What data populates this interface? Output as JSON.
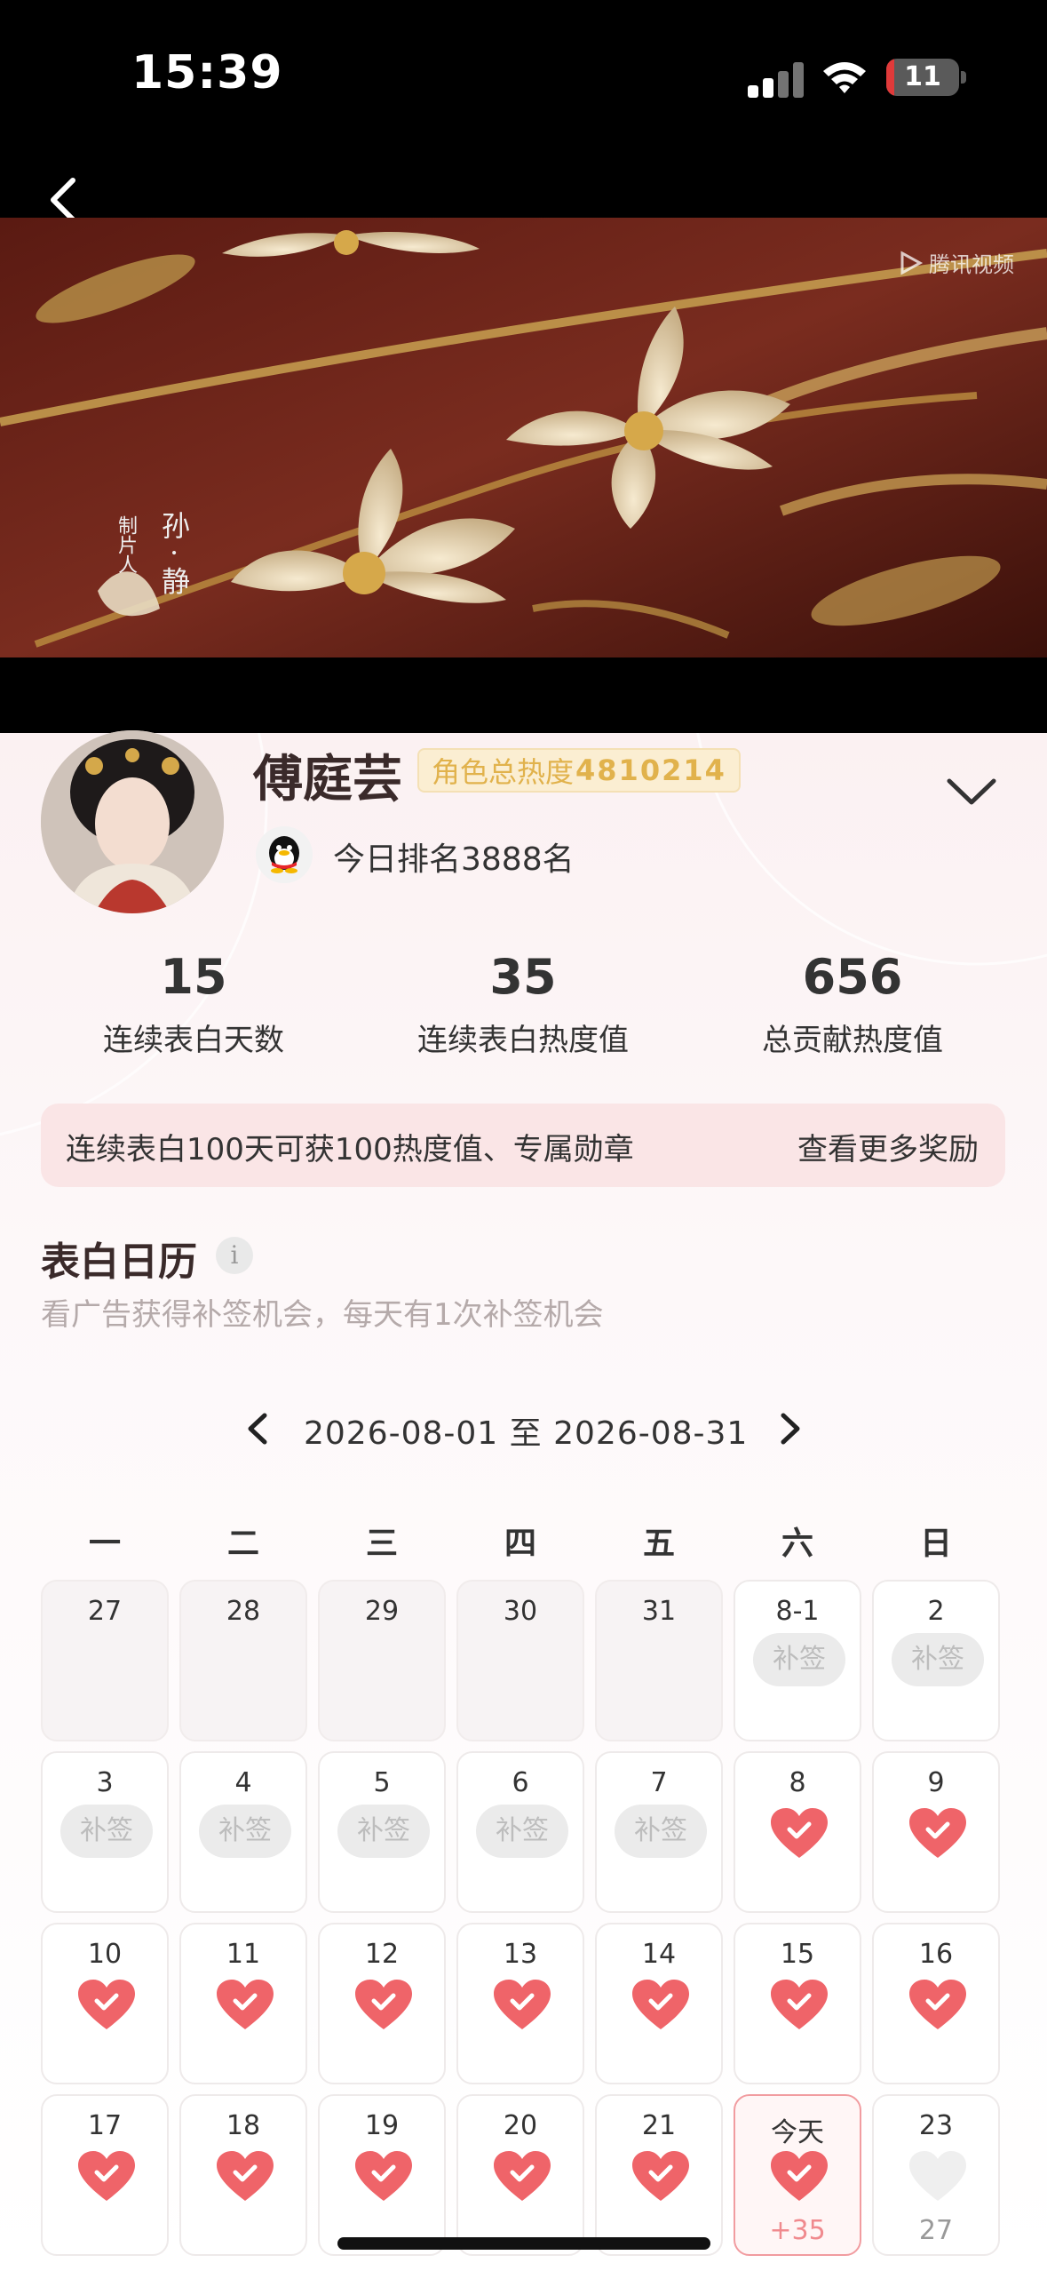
{
  "status_bar": {
    "time": "15:39",
    "battery_level": 11,
    "battery_label": "11"
  },
  "video": {
    "watermark": "腾讯视频",
    "credit_role": "制片人",
    "credit_name": "孙·静"
  },
  "profile": {
    "name": "傅庭芸",
    "heat_label": "角色总热度",
    "heat_value": "4810214",
    "rank_text": "今日排名3888名"
  },
  "stats": [
    {
      "value": "15",
      "label": "连续表白天数"
    },
    {
      "value": "35",
      "label": "连续表白热度值"
    },
    {
      "value": "656",
      "label": "总贡献热度值"
    }
  ],
  "reward_bar": {
    "text": "连续表白100天可获100热度值、专属勋章",
    "link": "查看更多奖励"
  },
  "calendar": {
    "title": "表白日历",
    "info_label": "i",
    "subtitle": "看广告获得补签机会，每天有1次补签机会",
    "range": "2026-08-01 至 2026-08-31",
    "weekdays": [
      "一",
      "二",
      "三",
      "四",
      "五",
      "六",
      "日"
    ],
    "makeup_label": "补签",
    "today_bonus": "+35",
    "partial_text": "27",
    "colors": {
      "heart": "#ef6469",
      "heart_empty": "#efefef",
      "today_border": "#f19ca0"
    },
    "weeks": [
      [
        {
          "day": "27",
          "state": "out"
        },
        {
          "day": "28",
          "state": "out"
        },
        {
          "day": "29",
          "state": "out"
        },
        {
          "day": "30",
          "state": "out"
        },
        {
          "day": "31",
          "state": "out"
        },
        {
          "day": "8-1",
          "state": "makeup"
        },
        {
          "day": "2",
          "state": "makeup"
        }
      ],
      [
        {
          "day": "3",
          "state": "makeup"
        },
        {
          "day": "4",
          "state": "makeup"
        },
        {
          "day": "5",
          "state": "makeup"
        },
        {
          "day": "6",
          "state": "makeup"
        },
        {
          "day": "7",
          "state": "makeup"
        },
        {
          "day": "8",
          "state": "checked"
        },
        {
          "day": "9",
          "state": "checked"
        }
      ],
      [
        {
          "day": "10",
          "state": "checked"
        },
        {
          "day": "11",
          "state": "checked"
        },
        {
          "day": "12",
          "state": "checked"
        },
        {
          "day": "13",
          "state": "checked"
        },
        {
          "day": "14",
          "state": "checked"
        },
        {
          "day": "15",
          "state": "checked"
        },
        {
          "day": "16",
          "state": "checked"
        }
      ],
      [
        {
          "day": "17",
          "state": "checked"
        },
        {
          "day": "18",
          "state": "checked"
        },
        {
          "day": "19",
          "state": "checked"
        },
        {
          "day": "20",
          "state": "checked"
        },
        {
          "day": "21",
          "state": "checked"
        },
        {
          "day": "今天",
          "state": "today"
        },
        {
          "day": "23",
          "state": "future"
        }
      ]
    ]
  }
}
